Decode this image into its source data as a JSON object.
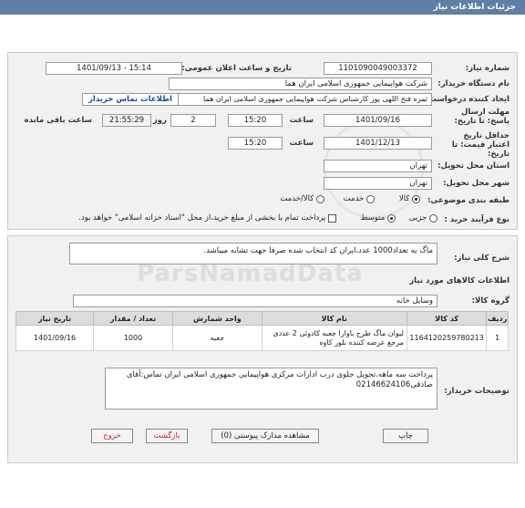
{
  "header": {
    "title": "جزئیات اطلاعات نیاز"
  },
  "fields": {
    "need_number_label": "شماره نیاز:",
    "need_number": "1101090049003372",
    "announce_label": "تاریخ و ساعت اعلان عمومی:",
    "announce_value": "1401/09/13 - 15:14",
    "buyer_org_label": "نام دستگاه خریدار:",
    "buyer_org": "شرکت هواپیمایی جمهوری اسلامی ایران هما",
    "requester_label": "ایجاد کننده درخواست:",
    "requester": "ثمره فتح اللهی پور کارشناس شرکت هواپیمایی جمهوری اسلامی ایران هما",
    "contact_link": "اطلاعات تماس خریدار",
    "deadline_label": "مهلت ارسال پاسخ: تا تاریخ:",
    "deadline_date": "1401/09/16",
    "time_word": "ساعت",
    "deadline_time": "15:20",
    "days_value": "2",
    "days_word": "روز و",
    "remaining_time": "21:55:29",
    "remaining_label": "ساعت باقی مانده",
    "validity_label": "حداقل تاریخ اعتبار قیمت: تا تاریخ:",
    "validity_date": "1401/12/13",
    "validity_time": "15:20",
    "province_label": "استان محل تحویل:",
    "province": "تهران",
    "city_label": "شهر محل تحویل:",
    "city": "تهران",
    "category_label": "طبقه بندی موضوعی:",
    "category_options": [
      "کالا",
      "خدمت",
      "کالا/خدمت"
    ],
    "process_label": "نوع فرآیند خرید :",
    "process_options": [
      "جزیی",
      "متوسط"
    ],
    "payment_note": "پرداخت تمام یا بخشی از مبلغ خرید،از محل \"اسناد خزانه اسلامی\" خواهد بود."
  },
  "summary": {
    "label": "شرح کلی نیاز:",
    "text": "ماگ به تعداد1000  عدد،ایران کد انتخاب شده صرفا جهت تشابه میباشد."
  },
  "goods": {
    "section_title": "اطلاعات کالاهای مورد نیاز",
    "group_label": "گروه کالا:",
    "group_value": "وسایل خانه",
    "columns": [
      "ردیف",
      "کد کالا",
      "نام کالا",
      "واحد شمارش",
      "تعداد / مقدار",
      "تاریخ نیاز"
    ],
    "rows": [
      {
        "row": "1",
        "code": "1164120259780213",
        "name": "لیوان ماگ طرح باوارا جعبه کادوئی 2 عددی مرجع عرضه کننده بلور کاوه",
        "unit": "جعبه",
        "qty": "1000",
        "date": "1401/09/16"
      }
    ]
  },
  "buyer_notes": {
    "label": "توضیحات خریدار:",
    "text": "پرداخت سه ماهه.تحویل جلوی درب ادارات مرکزی هواپیمایی جمهوری اسلامی ایران تماس:آقای صادقی02146624106"
  },
  "buttons": {
    "print": "چاپ",
    "attachments": "مشاهده مدارک پیوستی (0)",
    "back": "بازگشت",
    "exit": "خروج"
  },
  "watermark": "ParsNamadData"
}
